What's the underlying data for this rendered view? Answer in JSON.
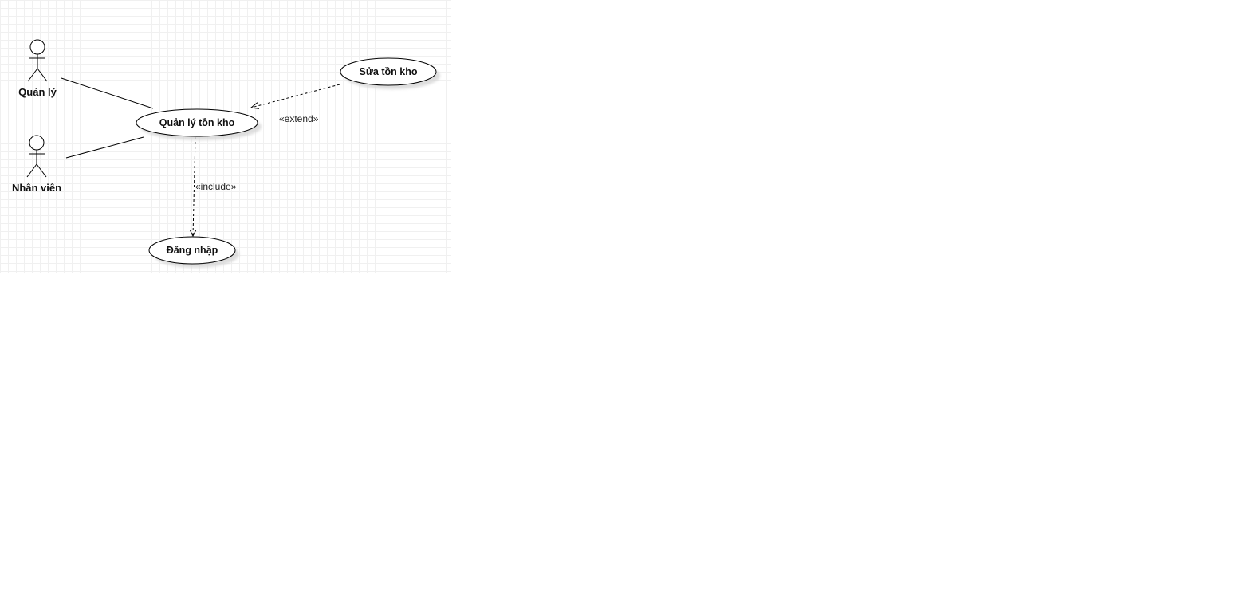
{
  "diagram": {
    "actors": [
      {
        "id": "quan-ly",
        "label": "Quản lý"
      },
      {
        "id": "nhan-vien",
        "label": "Nhân viên"
      }
    ],
    "use_cases": [
      {
        "id": "quan-ly-ton-kho",
        "label": "Quản lý tồn kho"
      },
      {
        "id": "sua-ton-kho",
        "label": "Sửa tồn kho"
      },
      {
        "id": "dang-nhap",
        "label": "Đăng nhập"
      }
    ],
    "relations": [
      {
        "type": "association",
        "from": "quan-ly",
        "to": "quan-ly-ton-kho"
      },
      {
        "type": "association",
        "from": "nhan-vien",
        "to": "quan-ly-ton-kho"
      },
      {
        "type": "extend",
        "from": "sua-ton-kho",
        "to": "quan-ly-ton-kho",
        "label": "«extend»"
      },
      {
        "type": "include",
        "from": "quan-ly-ton-kho",
        "to": "dang-nhap",
        "label": "«include»"
      }
    ]
  }
}
